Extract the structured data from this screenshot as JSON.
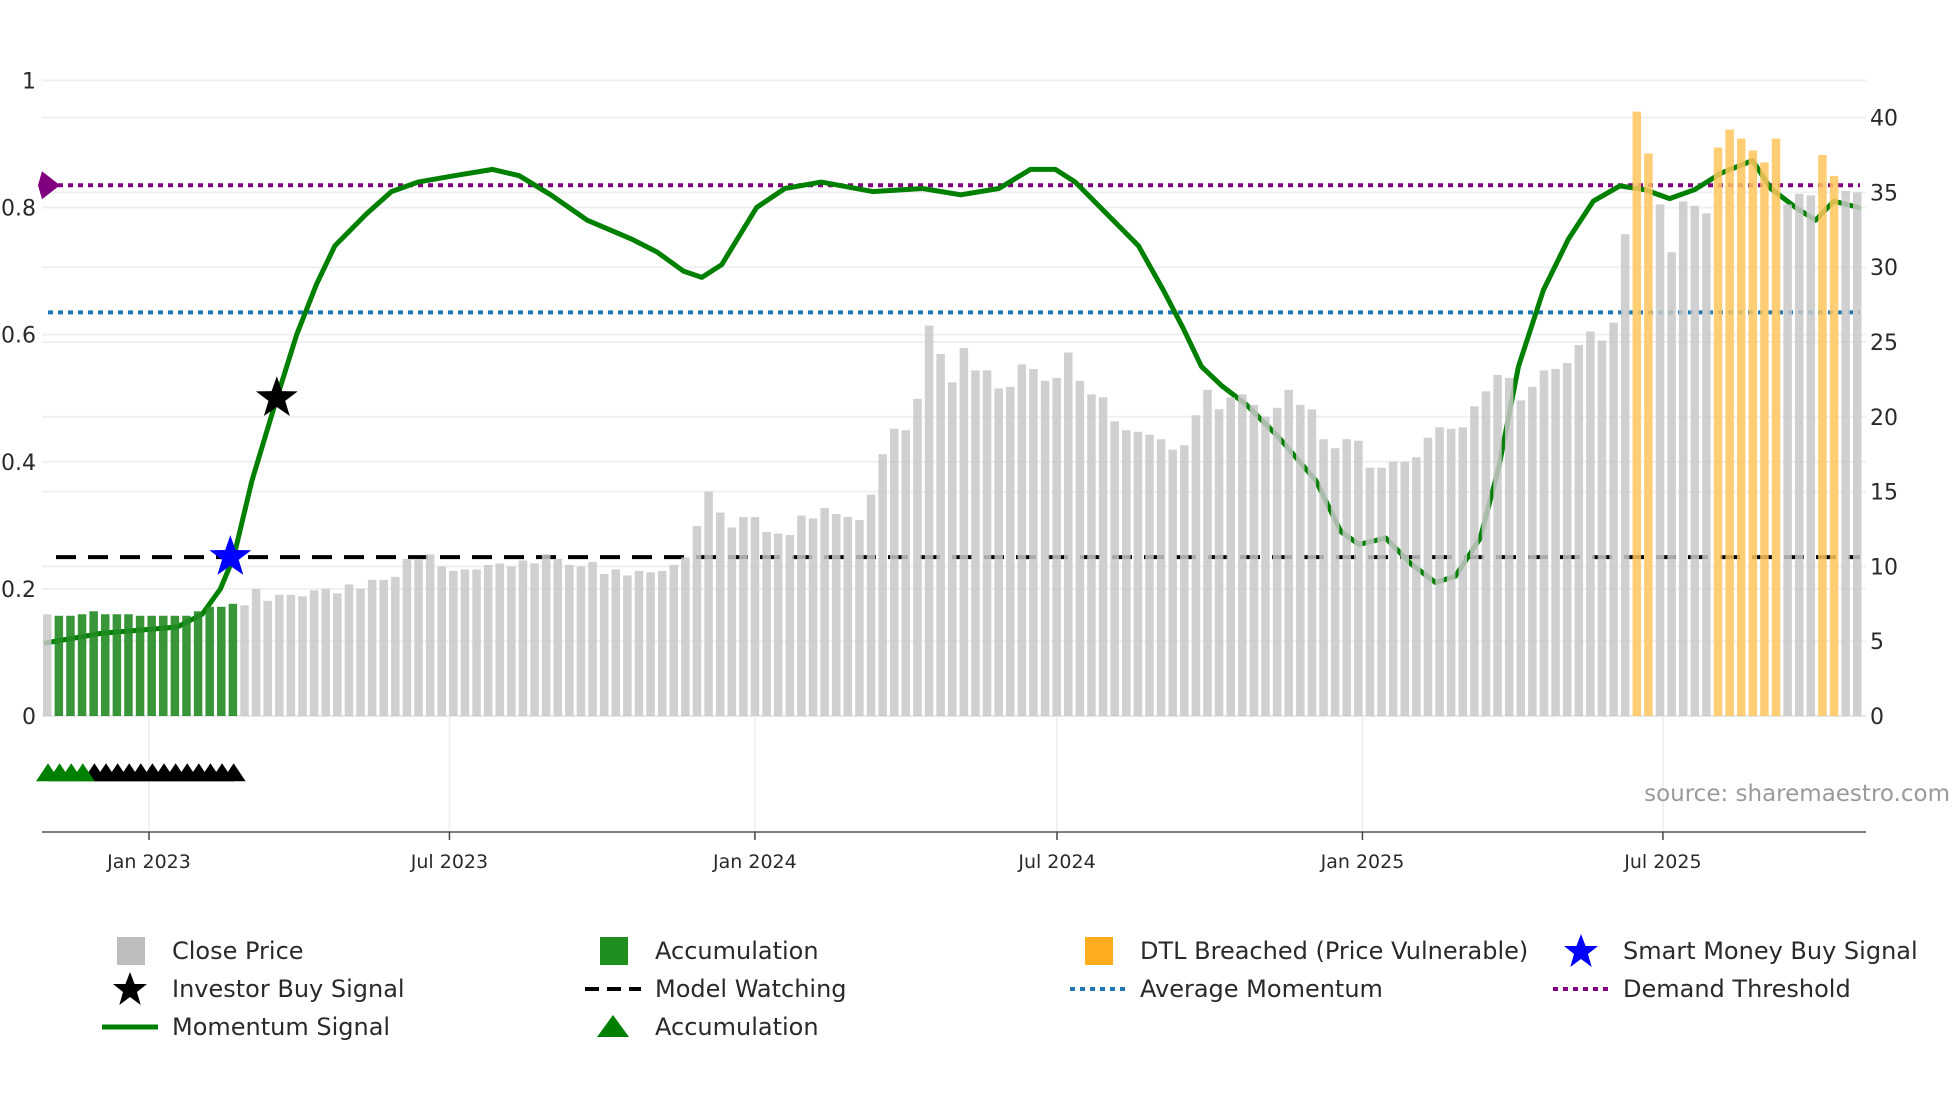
{
  "chart_data": {
    "type": "bar+line",
    "source": "source: sharemaestro.com",
    "left_axis": {
      "ticks": [
        0,
        0.2,
        0.4,
        0.6,
        0.8,
        1
      ],
      "tick_labels": [
        "0",
        "0.2",
        "0.4",
        "0.6",
        "0.8",
        "1"
      ],
      "range": [
        -0.183,
        1.07
      ]
    },
    "right_axis": {
      "ticks": [
        0,
        5,
        10,
        15,
        20,
        25,
        30,
        35,
        40
      ],
      "tick_labels": [
        "0",
        "5",
        "10",
        "15",
        "20",
        "25",
        "30",
        "35",
        "40"
      ],
      "range": [
        0,
        42
      ]
    },
    "x_axis": {
      "range": [
        "2022-10-29",
        "2025-10-29"
      ],
      "ticks": [
        {
          "date": "2023-01-01",
          "label": "Jan 2023"
        },
        {
          "date": "2023-07-01",
          "label": "Jul 2023"
        },
        {
          "date": "2024-01-01",
          "label": "Jan 2024"
        },
        {
          "date": "2024-07-01",
          "label": "Jul 2024"
        },
        {
          "date": "2025-01-01",
          "label": "Jan 2025"
        },
        {
          "date": "2025-07-01",
          "label": "Jul 2025"
        }
      ]
    },
    "close_price": {
      "frequency": "weekly",
      "values": [
        6.8,
        6.7,
        6.7,
        6.8,
        7.0,
        6.8,
        6.8,
        6.8,
        6.7,
        6.7,
        6.7,
        6.7,
        6.7,
        7.0,
        7.3,
        7.3,
        7.5,
        7.4,
        8.5,
        7.7,
        8.1,
        8.1,
        8.0,
        8.4,
        8.5,
        8.2,
        8.8,
        8.5,
        9.1,
        9.1,
        9.3,
        10.5,
        10.5,
        10.8,
        10.0,
        9.7,
        9.8,
        9.8,
        10.1,
        10.2,
        10.0,
        10.4,
        10.2,
        10.8,
        10.5,
        10.1,
        10.0,
        10.3,
        9.5,
        9.8,
        9.4,
        9.7,
        9.6,
        9.7,
        10.1,
        10.6,
        12.7,
        15.0,
        13.6,
        12.6,
        13.3,
        13.3,
        12.3,
        12.2,
        12.1,
        13.4,
        13.2,
        13.9,
        13.5,
        13.3,
        13.1,
        14.8,
        17.5,
        19.2,
        19.1,
        21.2,
        26.1,
        24.2,
        22.3,
        24.6,
        23.1,
        23.1,
        21.9,
        22.0,
        23.5,
        23.2,
        22.4,
        22.6,
        24.3,
        22.4,
        21.5,
        21.3,
        19.7,
        19.1,
        19.0,
        18.8,
        18.5,
        17.8,
        18.1,
        20.1,
        21.8,
        20.5,
        21.3,
        21.5,
        20.8,
        20.0,
        20.6,
        21.8,
        20.8,
        20.5,
        18.5,
        17.9,
        18.5,
        18.4,
        16.6,
        16.6,
        17.0,
        17.0,
        17.3,
        18.6,
        19.3,
        19.2,
        19.3,
        20.7,
        21.7,
        22.8,
        22.6,
        21.1,
        22.0,
        23.1,
        23.2,
        23.6,
        24.8,
        25.7,
        25.1,
        26.3,
        32.2,
        40.4,
        37.6,
        34.2,
        31.0,
        34.4,
        34.1,
        33.6,
        38.0,
        39.2,
        38.6,
        37.8,
        37.0,
        38.6,
        34.2,
        34.9,
        34.8,
        37.5,
        36.1,
        35.1,
        35.0
      ],
      "accumulation_bar_indices": [
        1,
        2,
        3,
        4,
        5,
        6,
        7,
        8,
        9,
        10,
        11,
        12,
        13,
        14,
        15,
        16
      ],
      "dtl_breached_bar_indices": [
        137,
        138,
        144,
        145,
        146,
        147,
        148,
        149,
        153,
        154
      ]
    },
    "momentum_signal": [
      [
        "2022-10-31",
        0.115
      ],
      [
        "2022-12-03",
        0.13
      ],
      [
        "2023-01-18",
        0.14
      ],
      [
        "2023-02-02",
        0.16
      ],
      [
        "2023-02-13",
        0.2
      ],
      [
        "2023-02-21",
        0.25
      ],
      [
        "2023-03-04",
        0.37
      ],
      [
        "2023-03-19",
        0.5
      ],
      [
        "2023-03-31",
        0.6
      ],
      [
        "2023-04-12",
        0.68
      ],
      [
        "2023-04-23",
        0.74
      ],
      [
        "2023-05-12",
        0.79
      ],
      [
        "2023-05-27",
        0.825
      ],
      [
        "2023-06-12",
        0.84
      ],
      [
        "2023-07-04",
        0.85
      ],
      [
        "2023-07-27",
        0.86
      ],
      [
        "2023-08-12",
        0.85
      ],
      [
        "2023-08-31",
        0.82
      ],
      [
        "2023-09-22",
        0.78
      ],
      [
        "2023-10-19",
        0.75
      ],
      [
        "2023-11-03",
        0.73
      ],
      [
        "2023-11-19",
        0.7
      ],
      [
        "2023-11-30",
        0.69
      ],
      [
        "2023-12-12",
        0.71
      ],
      [
        "2024-01-02",
        0.8
      ],
      [
        "2024-01-19",
        0.83
      ],
      [
        "2024-02-10",
        0.84
      ],
      [
        "2024-03-12",
        0.825
      ],
      [
        "2024-04-11",
        0.83
      ],
      [
        "2024-05-04",
        0.82
      ],
      [
        "2024-05-27",
        0.83
      ],
      [
        "2024-06-15",
        0.86
      ],
      [
        "2024-06-30",
        0.86
      ],
      [
        "2024-07-12",
        0.84
      ],
      [
        "2024-07-31",
        0.79
      ],
      [
        "2024-08-19",
        0.74
      ],
      [
        "2024-09-03",
        0.67
      ],
      [
        "2024-09-15",
        0.61
      ],
      [
        "2024-09-26",
        0.55
      ],
      [
        "2024-10-08",
        0.52
      ],
      [
        "2024-10-23",
        0.49
      ],
      [
        "2024-11-11",
        0.44
      ],
      [
        "2024-12-04",
        0.37
      ],
      [
        "2024-12-19",
        0.29
      ],
      [
        "2024-12-30",
        0.27
      ],
      [
        "2025-01-15",
        0.28
      ],
      [
        "2025-01-30",
        0.24
      ],
      [
        "2025-02-14",
        0.21
      ],
      [
        "2025-02-26",
        0.22
      ],
      [
        "2025-03-13",
        0.28
      ],
      [
        "2025-03-24",
        0.39
      ],
      [
        "2025-04-05",
        0.55
      ],
      [
        "2025-04-20",
        0.67
      ],
      [
        "2025-05-05",
        0.75
      ],
      [
        "2025-05-20",
        0.81
      ],
      [
        "2025-06-05",
        0.834
      ],
      [
        "2025-06-20",
        0.828
      ],
      [
        "2025-07-05",
        0.814
      ],
      [
        "2025-07-20",
        0.828
      ],
      [
        "2025-08-05",
        0.854
      ],
      [
        "2025-08-24",
        0.874
      ],
      [
        "2025-09-04",
        0.83
      ],
      [
        "2025-09-19",
        0.8
      ],
      [
        "2025-10-01",
        0.78
      ],
      [
        "2025-10-12",
        0.81
      ],
      [
        "2025-10-27",
        0.8
      ]
    ],
    "model_watching": 0.25,
    "average_momentum": 0.635,
    "demand_threshold": 0.835,
    "smart_money_buy_signal": {
      "date": "2023-02-19",
      "value": 0.25
    },
    "investor_buy_signal": {
      "date": "2023-03-19",
      "value": 0.5
    },
    "accumulation_markers": {
      "value": -0.09,
      "green_bar_indices": [
        0,
        1,
        2,
        3
      ],
      "black_bar_indices": [
        4,
        5,
        6,
        7,
        8,
        9,
        10,
        11,
        12,
        13,
        14,
        15,
        16
      ]
    },
    "colors": {
      "close": "#c8c8c8",
      "accumulation": "#228b22",
      "dtl": "#ffc65c",
      "momentum": "#008000",
      "average": "#1f77b4",
      "demand": "#800080",
      "watching": "#000000",
      "smart_money": "#0000ff",
      "investor": "#000000"
    },
    "legend": {
      "close_price": "Close Price",
      "accumulation_bar": "Accumulation",
      "dtl_breached": "DTL Breached (Price Vulnerable)",
      "smart_money": "Smart Money Buy Signal",
      "investor_buy": "Investor Buy Signal",
      "model_watching": "Model Watching",
      "average_momentum": "Average Momentum",
      "demand_threshold": "Demand Threshold",
      "momentum_signal": "Momentum Signal",
      "accumulation_marker": "Accumulation"
    }
  }
}
